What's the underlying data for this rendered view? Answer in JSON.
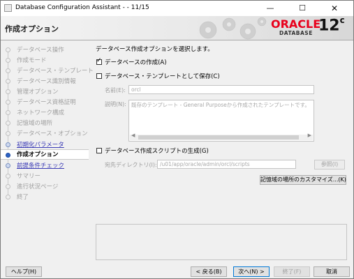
{
  "window": {
    "title": "Database Configuration Assistant - - 11/15",
    "min_glyph": "—",
    "max_glyph": "☐",
    "close_glyph": "✕"
  },
  "banner": {
    "step_title": "作成オプション",
    "brand": "ORACLE",
    "product": "DATABASE",
    "version": "12",
    "version_suffix": "c"
  },
  "nav": {
    "items": [
      {
        "label": "データベース操作",
        "state": "disabled"
      },
      {
        "label": "作成モード",
        "state": "disabled"
      },
      {
        "label": "データベース・テンプレート",
        "state": "disabled"
      },
      {
        "label": "データベース識別情報",
        "state": "disabled"
      },
      {
        "label": "管理オプション",
        "state": "disabled"
      },
      {
        "label": "データベース資格証明",
        "state": "disabled"
      },
      {
        "label": "ネットワーク構成",
        "state": "disabled"
      },
      {
        "label": "記憶域の場所",
        "state": "disabled"
      },
      {
        "label": "データベース・オプション",
        "state": "disabled"
      },
      {
        "label": "初期化パラメータ",
        "state": "link"
      },
      {
        "label": "作成オプション",
        "state": "active"
      },
      {
        "label": "前提条件チェック",
        "state": "link"
      },
      {
        "label": "サマリー",
        "state": "disabled"
      },
      {
        "label": "進行状況ページ",
        "state": "disabled"
      },
      {
        "label": "終了",
        "state": "disabled"
      }
    ]
  },
  "main": {
    "intro": "データベース作成オプションを選択します。",
    "create_db": {
      "label": "データベースの作成(A)",
      "checked": true
    },
    "save_template": {
      "label": "データベース・テンプレートとして保存(C)",
      "checked": false
    },
    "name": {
      "label": "名前(E):",
      "value": "orcl"
    },
    "description": {
      "label": "説明(N):",
      "value": "既存のテンプレート - General Purposeから作成されたテンプレートです。"
    },
    "gen_scripts": {
      "label": "データベース作成スクリプトの生成(G)",
      "checked": false
    },
    "dest_dir": {
      "label": "宛先ディレクトリ(I):",
      "value": "/u01/app/oracle/admin/orcl/scripts"
    },
    "browse_label": "参照(I)",
    "customize_label": "記憶域の場所のカスタマイズ...(K)"
  },
  "footer": {
    "help": "ヘルプ(H)",
    "back": "< 戻る(B)",
    "next": "次へ(N) >",
    "finish": "終了(F)",
    "cancel": "取消"
  }
}
